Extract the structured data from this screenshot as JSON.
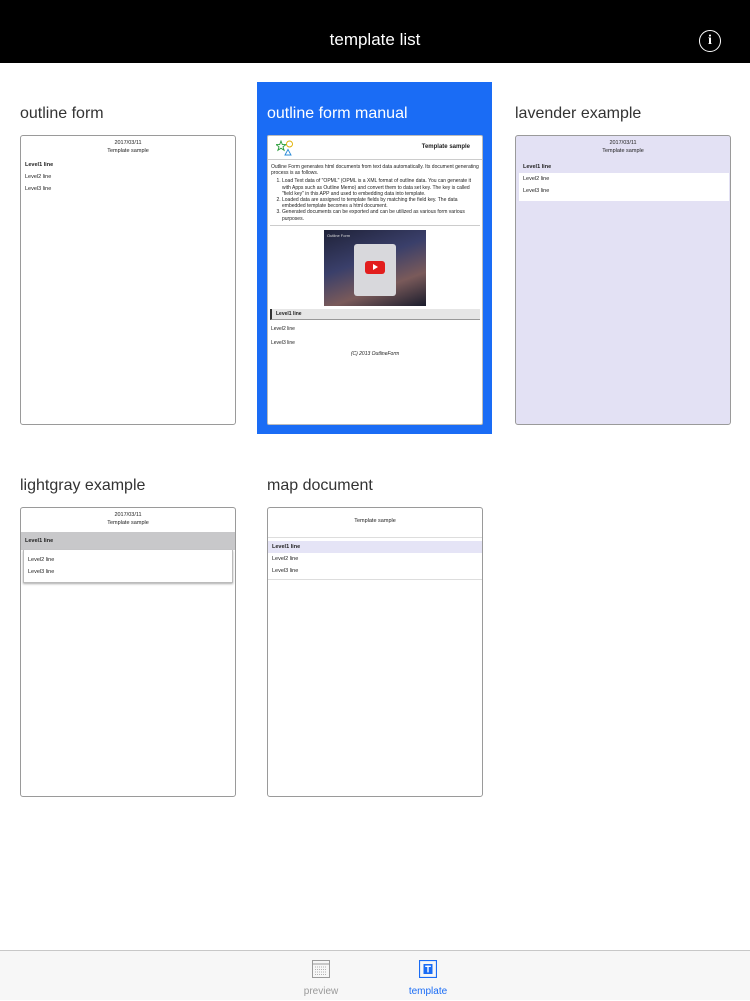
{
  "header": {
    "title": "template list",
    "info_label": "i"
  },
  "thumb_common": {
    "date": "2017/03/11",
    "sample": "Template sample",
    "level1": "Level1 line",
    "level2": "Level2 line",
    "level3": "Level3 line"
  },
  "templates": [
    {
      "title": "outline form"
    },
    {
      "title": "outline form manual"
    },
    {
      "title": "lavender example"
    },
    {
      "title": "lightgray example"
    },
    {
      "title": "map document"
    }
  ],
  "manual": {
    "title": "Template sample",
    "intro": "Outline Form generates html documents from text data automatically. Its document generating process is as follows.",
    "steps": [
      "Load Text data of \"OPML\" (OPML is a XML format of outline data. You can generate it with Apps such as Outline Memo) and convert them to data set key. The key is called \"field key\" in this APP and used to embedding data into template.",
      "Loaded data are assigned to template fields by matching the field key. The data embedded template becomes a html document.",
      "Generated documents can be exported and can be utilized as various form various purposes."
    ],
    "video_label": "Outline Form",
    "footer": "(C) 2013 OutlineForm"
  },
  "tabs": [
    {
      "label": "preview",
      "active": false
    },
    {
      "label": "template",
      "active": true
    }
  ],
  "colors": {
    "accent": "#1a6cf5",
    "navbar": "#000000",
    "lavender": "#e3e1f4",
    "lightgray": "#c8c8ca"
  }
}
